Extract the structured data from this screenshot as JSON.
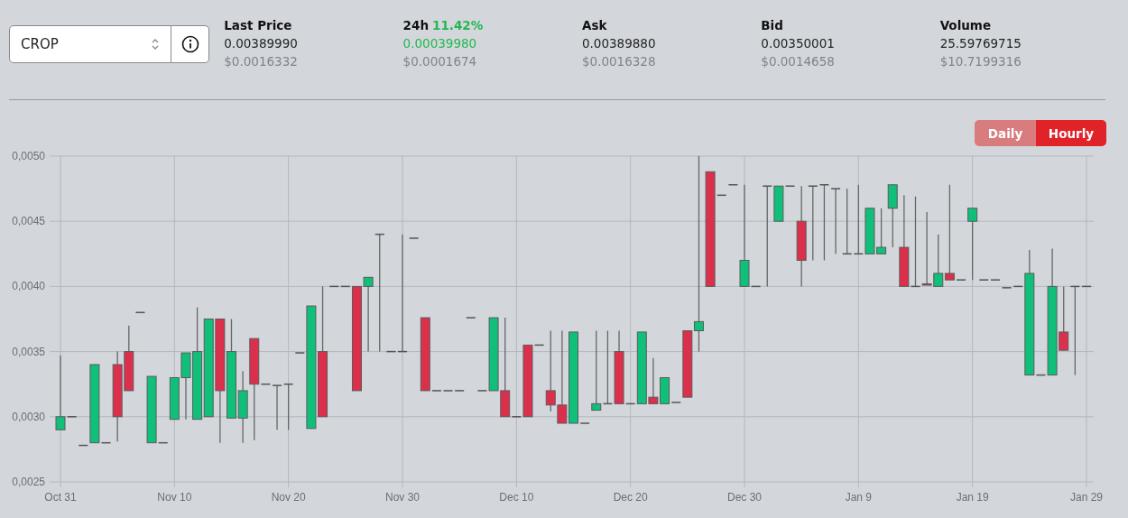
{
  "market_select": {
    "value": "CROP"
  },
  "stats": [
    {
      "kind": "price",
      "label": "Last Price",
      "value": "0.00389990",
      "usd": "$0.0016332"
    },
    {
      "kind": "change",
      "label": "24h",
      "change": "11.42%",
      "value": "0.00039980",
      "usd": "$0.0001674"
    },
    {
      "kind": "price",
      "label": "Ask",
      "value": "0.00389880",
      "usd": "$0.0016328"
    },
    {
      "kind": "price",
      "label": "Bid",
      "value": "0.00350001",
      "usd": "$0.0014658"
    },
    {
      "kind": "price",
      "label": "Volume",
      "value": "25.59769715",
      "usd": "$10.7199316"
    }
  ],
  "interval_tabs": [
    {
      "label": "Daily",
      "selected": false
    },
    {
      "label": "Hourly",
      "selected": true
    }
  ],
  "chart": {
    "chart_data": {
      "type": "candlestick",
      "grid": true,
      "ylim": [
        0.0025,
        0.005
      ],
      "categories": [
        "Oct 31",
        null,
        null,
        null,
        null,
        null,
        null,
        null,
        null,
        null,
        "Nov 10",
        null,
        null,
        null,
        null,
        null,
        null,
        null,
        null,
        null,
        "Nov 20",
        null,
        null,
        null,
        null,
        null,
        null,
        null,
        null,
        null,
        "Nov 30",
        null,
        null,
        null,
        null,
        null,
        null,
        null,
        null,
        null,
        "Dec 10",
        null,
        null,
        null,
        null,
        null,
        null,
        null,
        null,
        null,
        "Dec 20",
        null,
        null,
        null,
        null,
        null,
        null,
        null,
        null,
        null,
        "Dec 30",
        null,
        null,
        null,
        null,
        null,
        null,
        null,
        null,
        null,
        "Jan 9",
        null,
        null,
        null,
        null,
        null,
        null,
        null,
        null,
        null,
        "Jan 19",
        null,
        null,
        null,
        null,
        null,
        null,
        null,
        null,
        null,
        "Jan 29"
      ],
      "yticks": [
        {
          "value": 0.0025,
          "label": "0,0025"
        },
        {
          "value": 0.003,
          "label": "0,0030"
        },
        {
          "value": 0.0035,
          "label": "0,0035"
        },
        {
          "value": 0.004,
          "label": "0,0040"
        },
        {
          "value": 0.0045,
          "label": "0,0045"
        },
        {
          "value": 0.005,
          "label": "0,0050"
        }
      ],
      "ohlc": [
        [
          0.0029,
          0.00347,
          0.0029,
          0.003
        ],
        [
          0.003,
          0.003,
          0.003,
          0.003
        ],
        [
          0.00278,
          0.00278,
          0.00278,
          0.00278
        ],
        [
          0.0028,
          0.0034,
          0.0028,
          0.0034
        ],
        [
          0.0028,
          0.0028,
          0.0028,
          0.0028
        ],
        [
          0.0034,
          0.0035,
          0.00281,
          0.003
        ],
        [
          0.0035,
          0.0037,
          0.0032,
          0.0032
        ],
        [
          0.0038,
          0.0038,
          0.0038,
          0.0038
        ],
        [
          0.0028,
          0.00331,
          0.0028,
          0.00331
        ],
        [
          0.0028,
          0.0028,
          0.0028,
          0.0028
        ],
        [
          0.00298,
          0.0033,
          0.00298,
          0.0033
        ],
        [
          0.0033,
          0.00349,
          0.00298,
          0.00349
        ],
        [
          0.00298,
          0.00384,
          0.00298,
          0.0035
        ],
        [
          0.003,
          0.00375,
          0.003,
          0.00375
        ],
        [
          0.00375,
          0.00375,
          0.0028,
          0.0032
        ],
        [
          0.00299,
          0.00375,
          0.00299,
          0.0035
        ],
        [
          0.00299,
          0.00335,
          0.0028,
          0.0032
        ],
        [
          0.0036,
          0.0036,
          0.00282,
          0.00325
        ],
        [
          0.00325,
          0.00325,
          0.00325,
          0.00325
        ],
        [
          0.00324,
          0.00324,
          0.0029,
          0.00324
        ],
        [
          0.00325,
          0.00325,
          0.0029,
          0.00325
        ],
        [
          0.00349,
          0.00349,
          0.00349,
          0.00349
        ],
        [
          0.00291,
          0.00385,
          0.00291,
          0.00385
        ],
        [
          0.0035,
          0.004,
          0.003,
          0.003
        ],
        [
          0.004,
          0.004,
          0.004,
          0.004
        ],
        [
          0.004,
          0.004,
          0.004,
          0.004
        ],
        [
          0.004,
          0.004,
          0.0032,
          0.0032
        ],
        [
          0.004,
          0.00407,
          0.0035,
          0.00407
        ],
        [
          0.0044,
          0.0044,
          0.0035,
          0.0044
        ],
        [
          0.0035,
          0.0035,
          0.0035,
          0.0035
        ],
        [
          0.0035,
          0.0044,
          0.0035,
          0.0035
        ],
        [
          0.00437,
          0.00437,
          0.00437,
          0.00437
        ],
        [
          0.00376,
          0.00376,
          0.0032,
          0.0032
        ],
        [
          0.0032,
          0.0032,
          0.0032,
          0.0032
        ],
        [
          0.0032,
          0.0032,
          0.0032,
          0.0032
        ],
        [
          0.0032,
          0.0032,
          0.0032,
          0.0032
        ],
        [
          0.00376,
          0.00376,
          0.00376,
          0.00376
        ],
        [
          0.0032,
          0.0032,
          0.0032,
          0.0032
        ],
        [
          0.0032,
          0.00376,
          0.0032,
          0.00376
        ],
        [
          0.0032,
          0.00376,
          0.003,
          0.003
        ],
        [
          0.003,
          0.003,
          0.003,
          0.003
        ],
        [
          0.00355,
          0.00355,
          0.003,
          0.003
        ],
        [
          0.00355,
          0.00355,
          0.00355,
          0.00355
        ],
        [
          0.0032,
          0.00366,
          0.00304,
          0.00309
        ],
        [
          0.00309,
          0.00366,
          0.00295,
          0.00295
        ],
        [
          0.00295,
          0.00365,
          0.00295,
          0.00365
        ],
        [
          0.00295,
          0.00295,
          0.00295,
          0.00295
        ],
        [
          0.00305,
          0.00366,
          0.00305,
          0.0031
        ],
        [
          0.0031,
          0.00366,
          0.0031,
          0.0031
        ],
        [
          0.0035,
          0.00366,
          0.0031,
          0.0031
        ],
        [
          0.0031,
          0.0031,
          0.0031,
          0.0031
        ],
        [
          0.0031,
          0.00365,
          0.0031,
          0.00365
        ],
        [
          0.00315,
          0.00345,
          0.0031,
          0.0031
        ],
        [
          0.0031,
          0.0033,
          0.0031,
          0.0033
        ],
        [
          0.00311,
          0.00311,
          0.00311,
          0.00311
        ],
        [
          0.00366,
          0.00366,
          0.00315,
          0.00315
        ],
        [
          0.00366,
          0.005,
          0.0035,
          0.00373
        ],
        [
          0.00488,
          0.00488,
          0.004,
          0.004
        ],
        [
          0.0047,
          0.0047,
          0.0047,
          0.0047
        ],
        [
          0.00478,
          0.00478,
          0.00478,
          0.00478
        ],
        [
          0.004,
          0.00478,
          0.004,
          0.0042
        ],
        [
          0.004,
          0.004,
          0.004,
          0.004
        ],
        [
          0.00477,
          0.00477,
          0.004,
          0.00477
        ],
        [
          0.0045,
          0.00477,
          0.0045,
          0.00477
        ],
        [
          0.00477,
          0.00477,
          0.00477,
          0.00477
        ],
        [
          0.0045,
          0.00477,
          0.004,
          0.0042
        ],
        [
          0.00477,
          0.00477,
          0.0042,
          0.00477
        ],
        [
          0.00478,
          0.00478,
          0.0042,
          0.00478
        ],
        [
          0.00475,
          0.00475,
          0.00425,
          0.00475
        ],
        [
          0.00425,
          0.00475,
          0.00425,
          0.00425
        ],
        [
          0.00425,
          0.00478,
          0.00425,
          0.00425
        ],
        [
          0.00425,
          0.0046,
          0.00425,
          0.0046
        ],
        [
          0.00425,
          0.0046,
          0.00425,
          0.0043
        ],
        [
          0.0046,
          0.00478,
          0.0043,
          0.00478
        ],
        [
          0.0043,
          0.0047,
          0.004,
          0.004
        ],
        [
          0.004,
          0.00469,
          0.004,
          0.004
        ],
        [
          0.00402,
          0.00457,
          0.00401,
          0.00401
        ],
        [
          0.004,
          0.0044,
          0.004,
          0.0041
        ],
        [
          0.0041,
          0.00478,
          0.00405,
          0.00405
        ],
        [
          0.00405,
          0.00405,
          0.00405,
          0.00405
        ],
        [
          0.0045,
          0.0046,
          0.00405,
          0.0046
        ],
        [
          0.00405,
          0.00405,
          0.00405,
          0.00405
        ],
        [
          0.00405,
          0.00405,
          0.00405,
          0.00405
        ],
        [
          0.00399,
          0.00399,
          0.00399,
          0.00399
        ],
        [
          0.004,
          0.004,
          0.004,
          0.004
        ],
        [
          0.00332,
          0.00428,
          0.00332,
          0.0041
        ],
        [
          0.00332,
          0.00332,
          0.00332,
          0.00332
        ],
        [
          0.00332,
          0.00429,
          0.00332,
          0.004
        ],
        [
          0.00365,
          0.004,
          0.00351,
          0.00351
        ],
        [
          0.004,
          0.004,
          0.00332,
          0.004
        ],
        [
          0.004,
          0.004,
          0.004,
          0.004
        ]
      ]
    }
  }
}
